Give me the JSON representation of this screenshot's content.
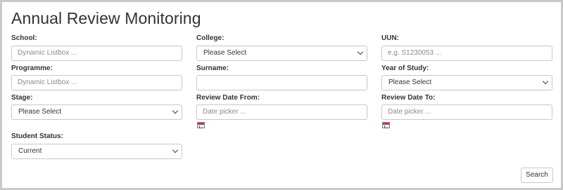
{
  "title": "Annual Review Monitoring",
  "fields": {
    "school": {
      "label": "School:",
      "placeholder": "Dynamic Listbox ..."
    },
    "college": {
      "label": "College:",
      "value": "Please Select"
    },
    "uun": {
      "label": "UUN:",
      "placeholder": "e.g. S1230053 ..."
    },
    "programme": {
      "label": "Programme:",
      "placeholder": "Dynamic Listbox ..."
    },
    "surname": {
      "label": "Surname:",
      "value": ""
    },
    "year_of_study": {
      "label": "Year of Study:",
      "value": "Please Select"
    },
    "stage": {
      "label": "Stage:",
      "value": "Please Select"
    },
    "review_date_from": {
      "label": "Review Date From:",
      "placeholder": "Date picker ..."
    },
    "review_date_to": {
      "label": "Review Date To:",
      "placeholder": "Date picker ..."
    },
    "student_status": {
      "label": "Student Status:",
      "value": "Current"
    }
  },
  "icons": {
    "calendar": "calendar-icon",
    "dropdown": "chevron-down-icon"
  },
  "search_button": "Search",
  "colors": {
    "border": "#c7c7c7",
    "frame": "#c9c9c9",
    "text": "#333333",
    "placeholder": "#8a8a8a"
  }
}
